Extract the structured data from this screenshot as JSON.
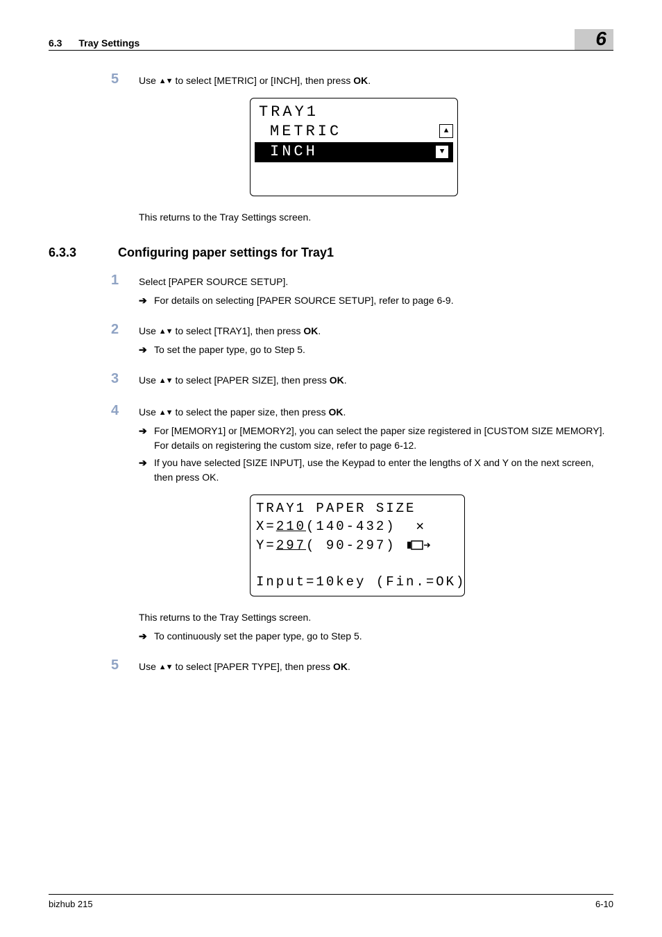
{
  "header": {
    "section_number": "6.3",
    "section_title": "Tray Settings",
    "chapter_number": "6"
  },
  "step5a": {
    "num": "5",
    "pre": "Use ",
    "mid": " to select [METRIC] or [INCH], then press ",
    "ok_label": "OK",
    "post": "."
  },
  "lcd1": {
    "line1": "TRAY1",
    "line2": "METRIC",
    "line3": "INCH"
  },
  "after_lcd1": "This returns to the Tray Settings screen.",
  "heading": {
    "num": "6.3.3",
    "title": "Configuring paper settings for Tray1"
  },
  "step1": {
    "num": "1",
    "body": "Select [PAPER SOURCE SETUP].",
    "sub1": "For details on selecting [PAPER SOURCE SETUP], refer to page 6-9."
  },
  "step2": {
    "num": "2",
    "pre": "Use ",
    "mid": " to select [TRAY1], then press ",
    "ok_label": "OK",
    "post": ".",
    "sub1": "To set the paper type, go to Step 5."
  },
  "step3": {
    "num": "3",
    "pre": "Use ",
    "mid": " to select [PAPER SIZE], then press ",
    "ok_label": "OK",
    "post": "."
  },
  "step4": {
    "num": "4",
    "pre": "Use ",
    "mid": " to select the paper size, then press ",
    "ok_label": "OK",
    "post": ".",
    "sub1": "For [MEMORY1] or [MEMORY2], you can select the paper size registered in [CUSTOM SIZE MEMORY]. For details on registering the custom size, refer to page 6-12.",
    "sub2_pre": "If you have selected [SIZE INPUT], use the ",
    "sub2_keypad": "Keypad",
    "sub2_mid": " to enter the lengths of X and Y on the next screen, then press ",
    "sub2_ok": "OK",
    "sub2_post": "."
  },
  "lcd2": {
    "line1": "TRAY1 PAPER SIZE",
    "line2_pre": " X=",
    "line2_val": "210",
    "line2_range": "(140-432)",
    "line3_pre": " Y=",
    "line3_val": "297",
    "line3_range": "( 90-297)",
    "line5": "Input=10key (Fin.=OK)"
  },
  "after_lcd2": "This returns to the Tray Settings screen.",
  "after_lcd2_sub": "To continuously set the paper type, go to Step 5.",
  "step5b": {
    "num": "5",
    "pre": "Use ",
    "mid": " to select [PAPER TYPE], then press ",
    "ok_label": "OK",
    "post": "."
  },
  "footer": {
    "left": "bizhub 215",
    "right": "6-10"
  }
}
